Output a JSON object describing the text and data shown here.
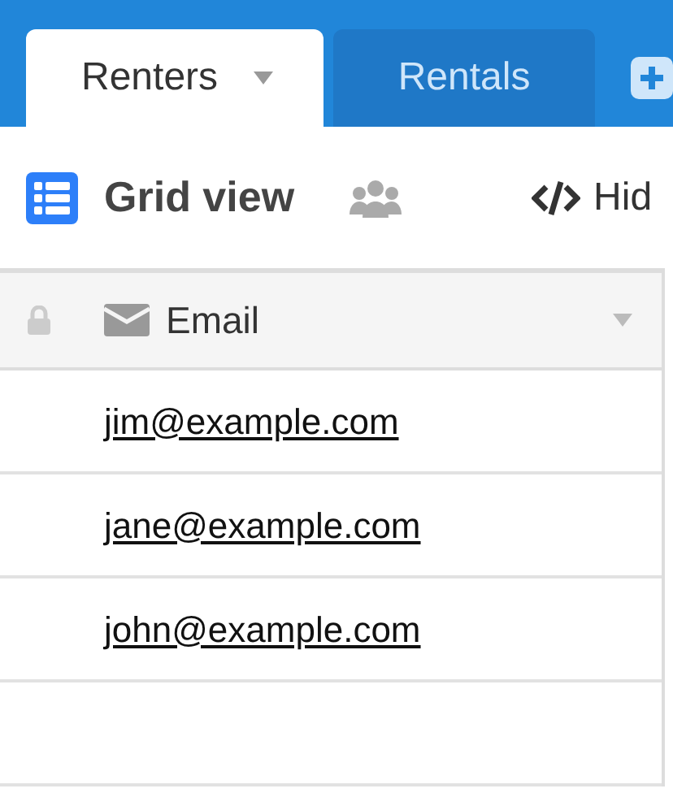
{
  "tabs": [
    {
      "label": "Renters",
      "selected": true
    },
    {
      "label": "Rentals",
      "selected": false
    }
  ],
  "toolbar": {
    "view_name": "Grid view",
    "hide_button": "Hid"
  },
  "table": {
    "columns": [
      {
        "label": "Email"
      }
    ],
    "rows": [
      {
        "email": "jim@example.com"
      },
      {
        "email": "jane@example.com"
      },
      {
        "email": "john@example.com"
      }
    ]
  }
}
